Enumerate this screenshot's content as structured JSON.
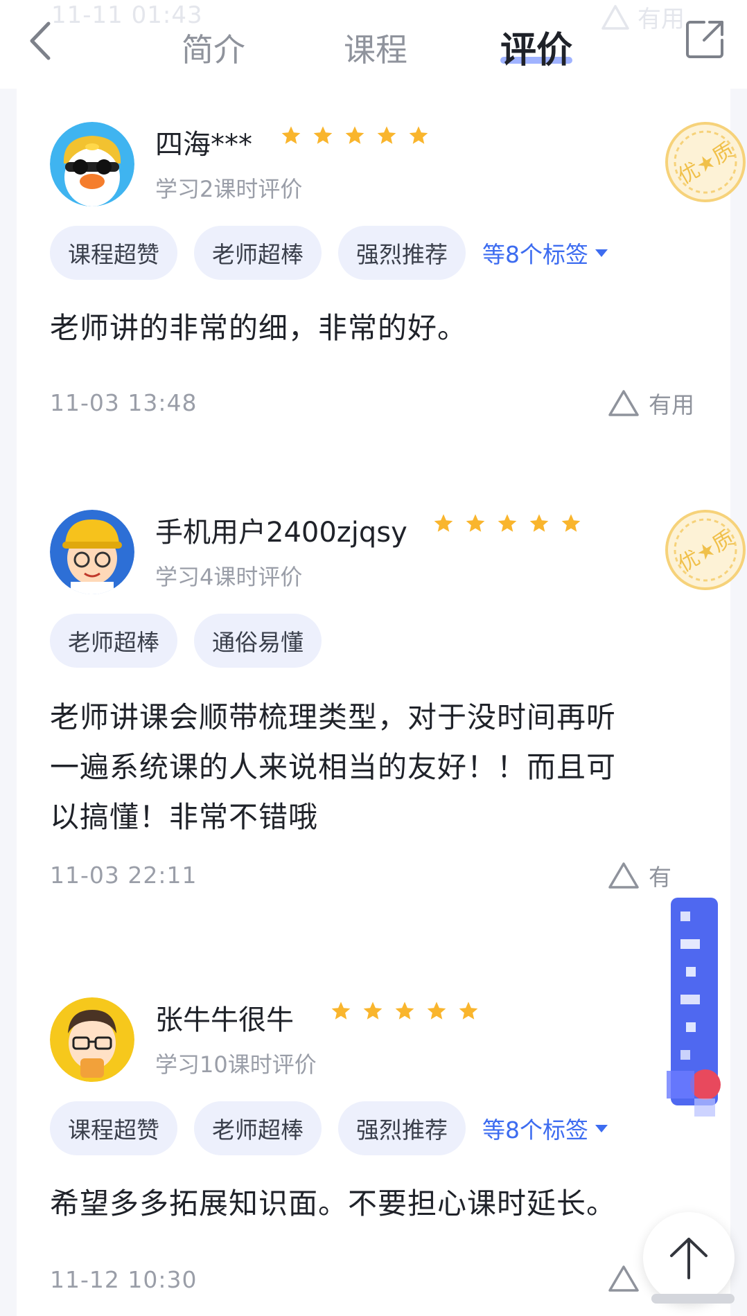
{
  "header": {
    "ghost_timestamp": "11-11 01:43",
    "ghost_useful": "有用",
    "tabs": [
      {
        "label": "简介"
      },
      {
        "label": "课程"
      },
      {
        "label": "评价"
      }
    ],
    "active_tab": "评价"
  },
  "reviews": [
    {
      "user": "四海***",
      "rating": 5,
      "study": "学习2课时评价",
      "tags": [
        "课程超赞",
        "老师超棒",
        "强烈推荐"
      ],
      "more_tags": "等8个标签",
      "text": "老师讲的非常的细，非常的好。",
      "timestamp": "11-03 13:48",
      "useful": "有用",
      "badge": "优质"
    },
    {
      "user": "手机用户2400zjqsy",
      "rating": 5,
      "study": "学习4课时评价",
      "tags": [
        "老师超棒",
        "通俗易懂"
      ],
      "text_lines": [
        "老师讲课会顺带梳理类型，对于没时间再听",
        "一遍系统课的人来说相当的友好！！而且可",
        "以搞懂！非常不错哦"
      ],
      "timestamp": "11-03 22:11",
      "useful": "有",
      "badge": "优质"
    },
    {
      "user": "张牛牛很牛",
      "rating": 5,
      "study": "学习10课时评价",
      "tags": [
        "课程超赞",
        "老师超棒",
        "强烈推荐"
      ],
      "more_tags": "等8个标签",
      "text": "希望多多拓展知识面。不要担心课时延长。",
      "timestamp": "11-12 10:30"
    }
  ],
  "colors": {
    "star": "#f9b52d",
    "tag_bg": "#edf0fc",
    "accent_blue": "#3d6cf0",
    "badge": "#f6c44a"
  }
}
